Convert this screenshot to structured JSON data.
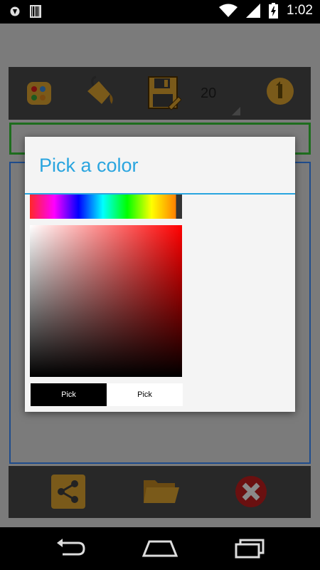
{
  "status_bar": {
    "time": "1:02",
    "battery_level": "charging"
  },
  "toolbar": {
    "brush_size": "20",
    "icons": [
      "palette-icon",
      "paint-bucket-icon",
      "save-icon",
      "info-icon"
    ]
  },
  "bottom_bar": {
    "icons": [
      "share-icon",
      "folder-icon",
      "close-icon"
    ]
  },
  "dialog": {
    "title": "Pick a color",
    "old_color_label": "Pick",
    "new_color_label": "Pick",
    "old_color": "#000000",
    "new_color": "#ffffff"
  },
  "colors": {
    "accent": "#2aa5df",
    "toolbar_bg": "#282828",
    "dim_bg": "#7b7b7b"
  },
  "nav_bar": {
    "icons": [
      "back-icon",
      "home-icon",
      "recents-icon"
    ]
  }
}
